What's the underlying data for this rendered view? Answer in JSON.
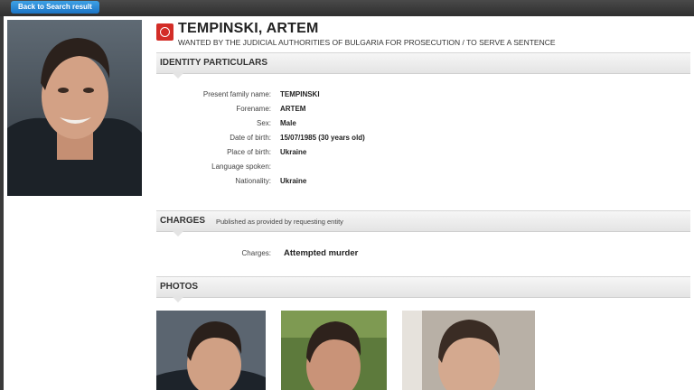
{
  "nav": {
    "back_label": "Back to Search result"
  },
  "person": {
    "name": "TEMPINSKI, ARTEM",
    "subtitle": "WANTED BY THE JUDICIAL AUTHORITIES OF BULGARIA FOR PROSECUTION / TO SERVE A SENTENCE"
  },
  "identity": {
    "heading": "IDENTITY PARTICULARS",
    "rows": [
      {
        "label": "Present family name:",
        "value": "TEMPINSKI"
      },
      {
        "label": "Forename:",
        "value": "ARTEM"
      },
      {
        "label": "Sex:",
        "value": "Male"
      },
      {
        "label": "Date of birth:",
        "value": "15/07/1985 (30 years old)"
      },
      {
        "label": "Place of birth:",
        "value": "Ukraine"
      },
      {
        "label": "Language spoken:",
        "value": ""
      },
      {
        "label": "Nationality:",
        "value": "Ukraine"
      }
    ]
  },
  "charges": {
    "heading": "CHARGES",
    "note": "Published as provided by requesting entity",
    "label": "Charges:",
    "value": "Attempted murder"
  },
  "photos": {
    "heading": "PHOTOS"
  },
  "icons": {
    "emblem": "wanted-emblem-icon"
  },
  "colors": {
    "back_button": "#1a73c4",
    "emblem": "#d32d27"
  }
}
